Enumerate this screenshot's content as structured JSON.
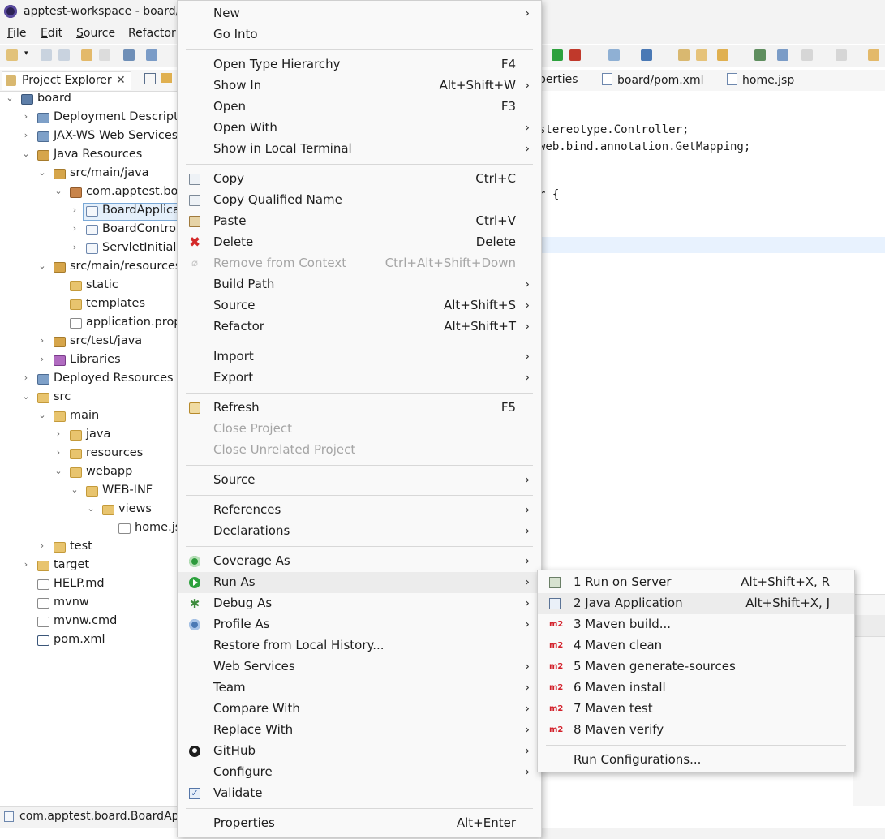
{
  "window": {
    "title": "apptest-workspace - board/s"
  },
  "menubar": [
    {
      "label": "File",
      "mnemonic": "F",
      "rest": "ile"
    },
    {
      "label": "Edit",
      "mnemonic": "E",
      "rest": "dit"
    },
    {
      "label": "Source",
      "mnemonic": "S",
      "rest": "ource"
    },
    {
      "label": "Refactor",
      "mnemonic": "",
      "rest": "Refactor"
    }
  ],
  "project_explorer": {
    "tab_label": "Project Explorer",
    "close_glyph": "✕",
    "tree": [
      {
        "label": "board",
        "indent": 0,
        "chev": "⌄",
        "icon": "proj"
      },
      {
        "label": "Deployment Descripto",
        "indent": 1,
        "chev": "›",
        "icon": "web"
      },
      {
        "label": "JAX-WS Web Services",
        "indent": 1,
        "chev": "›",
        "icon": "web"
      },
      {
        "label": "Java Resources",
        "indent": 1,
        "chev": "⌄",
        "icon": "pkgfolder"
      },
      {
        "label": "src/main/java",
        "indent": 2,
        "chev": "⌄",
        "icon": "pkgfolder"
      },
      {
        "label": "com.apptest.boa",
        "indent": 3,
        "chev": "⌄",
        "icon": "pkg"
      },
      {
        "label": "BoardApplica",
        "indent": 4,
        "chev": "›",
        "icon": "jfile",
        "selected": true
      },
      {
        "label": "BoardControl",
        "indent": 4,
        "chev": "›",
        "icon": "jfile"
      },
      {
        "label": "ServletInitializ",
        "indent": 4,
        "chev": "›",
        "icon": "jfile"
      },
      {
        "label": "src/main/resources",
        "indent": 2,
        "chev": "⌄",
        "icon": "pkgfolder"
      },
      {
        "label": "static",
        "indent": 3,
        "chev": "",
        "icon": "folder"
      },
      {
        "label": "templates",
        "indent": 3,
        "chev": "",
        "icon": "folder"
      },
      {
        "label": "application.prop",
        "indent": 3,
        "chev": "",
        "icon": "file"
      },
      {
        "label": "src/test/java",
        "indent": 2,
        "chev": "›",
        "icon": "pkgfolder"
      },
      {
        "label": "Libraries",
        "indent": 2,
        "chev": "›",
        "icon": "lib"
      },
      {
        "label": "Deployed Resources",
        "indent": 1,
        "chev": "›",
        "icon": "web"
      },
      {
        "label": "src",
        "indent": 1,
        "chev": "⌄",
        "icon": "folder"
      },
      {
        "label": "main",
        "indent": 2,
        "chev": "⌄",
        "icon": "folder"
      },
      {
        "label": "java",
        "indent": 3,
        "chev": "›",
        "icon": "folder"
      },
      {
        "label": "resources",
        "indent": 3,
        "chev": "›",
        "icon": "folder"
      },
      {
        "label": "webapp",
        "indent": 3,
        "chev": "⌄",
        "icon": "folder"
      },
      {
        "label": "WEB-INF",
        "indent": 4,
        "chev": "⌄",
        "icon": "folder"
      },
      {
        "label": "views",
        "indent": 5,
        "chev": "⌄",
        "icon": "folder"
      },
      {
        "label": "home.js",
        "indent": 6,
        "chev": "",
        "icon": "file"
      },
      {
        "label": "test",
        "indent": 2,
        "chev": "›",
        "icon": "folder"
      },
      {
        "label": "target",
        "indent": 1,
        "chev": "›",
        "icon": "folder"
      },
      {
        "label": "HELP.md",
        "indent": 1,
        "chev": "",
        "icon": "file"
      },
      {
        "label": "mvnw",
        "indent": 1,
        "chev": "",
        "icon": "file"
      },
      {
        "label": "mvnw.cmd",
        "indent": 1,
        "chev": "",
        "icon": "file"
      },
      {
        "label": "pom.xml",
        "indent": 1,
        "chev": "",
        "icon": "mfile"
      }
    ]
  },
  "status_bar": {
    "text": "com.apptest.board.BoardApp"
  },
  "editor": {
    "tabs": [
      "perties",
      "board/pom.xml",
      "home.jsp"
    ],
    "code_lines": [
      "stereotype.Controller;",
      "web.bind.annotation.GetMapping;",
      "",
      "r {"
    ]
  },
  "context_menu": [
    {
      "type": "item",
      "label": "New",
      "submenu": true
    },
    {
      "type": "item",
      "label": "Go Into"
    },
    {
      "type": "sep"
    },
    {
      "type": "item",
      "label": "Open Type Hierarchy",
      "shortcut": "F4"
    },
    {
      "type": "item",
      "label": "Show In",
      "shortcut": "Alt+Shift+W",
      "submenu": true
    },
    {
      "type": "item",
      "label": "Open",
      "shortcut": "F3"
    },
    {
      "type": "item",
      "label": "Open With",
      "submenu": true
    },
    {
      "type": "item",
      "label": "Show in Local Terminal",
      "submenu": true
    },
    {
      "type": "sep"
    },
    {
      "type": "item",
      "label": "Copy",
      "shortcut": "Ctrl+C",
      "icon": "copy-icon"
    },
    {
      "type": "item",
      "label": "Copy Qualified Name",
      "icon": "copy-qualified-icon"
    },
    {
      "type": "item",
      "label": "Paste",
      "shortcut": "Ctrl+V",
      "icon": "paste-icon"
    },
    {
      "type": "item",
      "label": "Delete",
      "shortcut": "Delete",
      "icon": "delete-icon"
    },
    {
      "type": "item",
      "label": "Remove from Context",
      "shortcut": "Ctrl+Alt+Shift+Down",
      "disabled": true,
      "icon": "remove-context-icon"
    },
    {
      "type": "item",
      "label": "Build Path",
      "submenu": true
    },
    {
      "type": "item",
      "label": "Source",
      "shortcut": "Alt+Shift+S",
      "submenu": true
    },
    {
      "type": "item",
      "label": "Refactor",
      "shortcut": "Alt+Shift+T",
      "submenu": true
    },
    {
      "type": "sep"
    },
    {
      "type": "item",
      "label": "Import",
      "submenu": true
    },
    {
      "type": "item",
      "label": "Export",
      "submenu": true
    },
    {
      "type": "sep"
    },
    {
      "type": "item",
      "label": "Refresh",
      "shortcut": "F5",
      "icon": "refresh-icon"
    },
    {
      "type": "item",
      "label": "Close Project",
      "disabled": true
    },
    {
      "type": "item",
      "label": "Close Unrelated Project",
      "disabled": true
    },
    {
      "type": "sep"
    },
    {
      "type": "item",
      "label": "Source",
      "submenu": true
    },
    {
      "type": "sep"
    },
    {
      "type": "item",
      "label": "References",
      "submenu": true
    },
    {
      "type": "item",
      "label": "Declarations",
      "submenu": true
    },
    {
      "type": "sep"
    },
    {
      "type": "item",
      "label": "Coverage As",
      "submenu": true,
      "icon": "coverage-icon"
    },
    {
      "type": "item",
      "label": "Run As",
      "submenu": true,
      "icon": "run-icon",
      "hover": true
    },
    {
      "type": "item",
      "label": "Debug As",
      "submenu": true,
      "icon": "debug-icon"
    },
    {
      "type": "item",
      "label": "Profile As",
      "submenu": true,
      "icon": "profile-icon"
    },
    {
      "type": "item",
      "label": "Restore from Local History..."
    },
    {
      "type": "item",
      "label": "Web Services",
      "submenu": true
    },
    {
      "type": "item",
      "label": "Team",
      "submenu": true
    },
    {
      "type": "item",
      "label": "Compare With",
      "submenu": true
    },
    {
      "type": "item",
      "label": "Replace With",
      "submenu": true
    },
    {
      "type": "item",
      "label": "GitHub",
      "submenu": true,
      "icon": "github-icon"
    },
    {
      "type": "item",
      "label": "Configure",
      "submenu": true
    },
    {
      "type": "item",
      "label": "Validate",
      "icon": "validate-check-icon"
    },
    {
      "type": "sep"
    },
    {
      "type": "item",
      "label": "Properties",
      "shortcut": "Alt+Enter"
    }
  ],
  "run_as_submenu": [
    {
      "type": "item",
      "label": "1 Run on Server",
      "shortcut": "Alt+Shift+X, R",
      "icon": "server-icon"
    },
    {
      "type": "item",
      "label": "2 Java Application",
      "shortcut": "Alt+Shift+X, J",
      "icon": "java-app-icon",
      "hover": true
    },
    {
      "type": "item",
      "label": "3 Maven build...",
      "icon": "m2-icon"
    },
    {
      "type": "item",
      "label": "4 Maven clean",
      "icon": "m2-icon"
    },
    {
      "type": "item",
      "label": "5 Maven generate-sources",
      "icon": "m2-icon"
    },
    {
      "type": "item",
      "label": "6 Maven install",
      "icon": "m2-icon"
    },
    {
      "type": "item",
      "label": "7 Maven test",
      "icon": "m2-icon"
    },
    {
      "type": "item",
      "label": "8 Maven verify",
      "icon": "m2-icon"
    },
    {
      "type": "sep"
    },
    {
      "type": "item",
      "label": "Run Configurations..."
    }
  ],
  "glyphs": {
    "submenu_arrow": "›",
    "m2": "m2",
    "check": "✓",
    "delete_x": "✖"
  }
}
